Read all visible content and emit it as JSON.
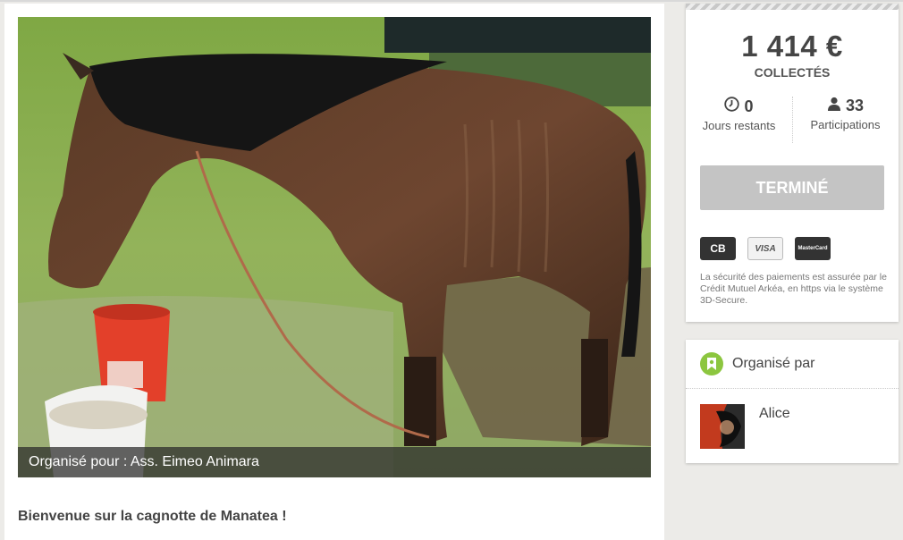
{
  "campaign": {
    "organized_for": "Organisé pour : Ass. Eimeo Animara",
    "welcome": "Bienvenue sur la cagnotte de Manatea !"
  },
  "funding": {
    "amount": "1 414 €",
    "amount_label": "COLLECTÉS",
    "days_left_value": "0",
    "days_left_label": "Jours restants",
    "participants_value": "33",
    "participants_label": "Participations",
    "status_button": "TERMINÉ",
    "security_text": "La sécurité des paiements est assurée par le Crédit Mutuel Arkéa, en https via le système 3D-Secure."
  },
  "payment_logos": {
    "cb": "CB",
    "visa": "VISA",
    "mastercard": "MasterCard"
  },
  "organizer": {
    "title": "Organisé par",
    "name": "Alice"
  },
  "icons": {
    "clock": "clock-icon",
    "person": "person-icon",
    "badge": "ribbon-badge-icon"
  },
  "colors": {
    "accent_green": "#8cc63f",
    "button_disabled": "#c4c4c4",
    "page_bg": "#ecebe8"
  }
}
